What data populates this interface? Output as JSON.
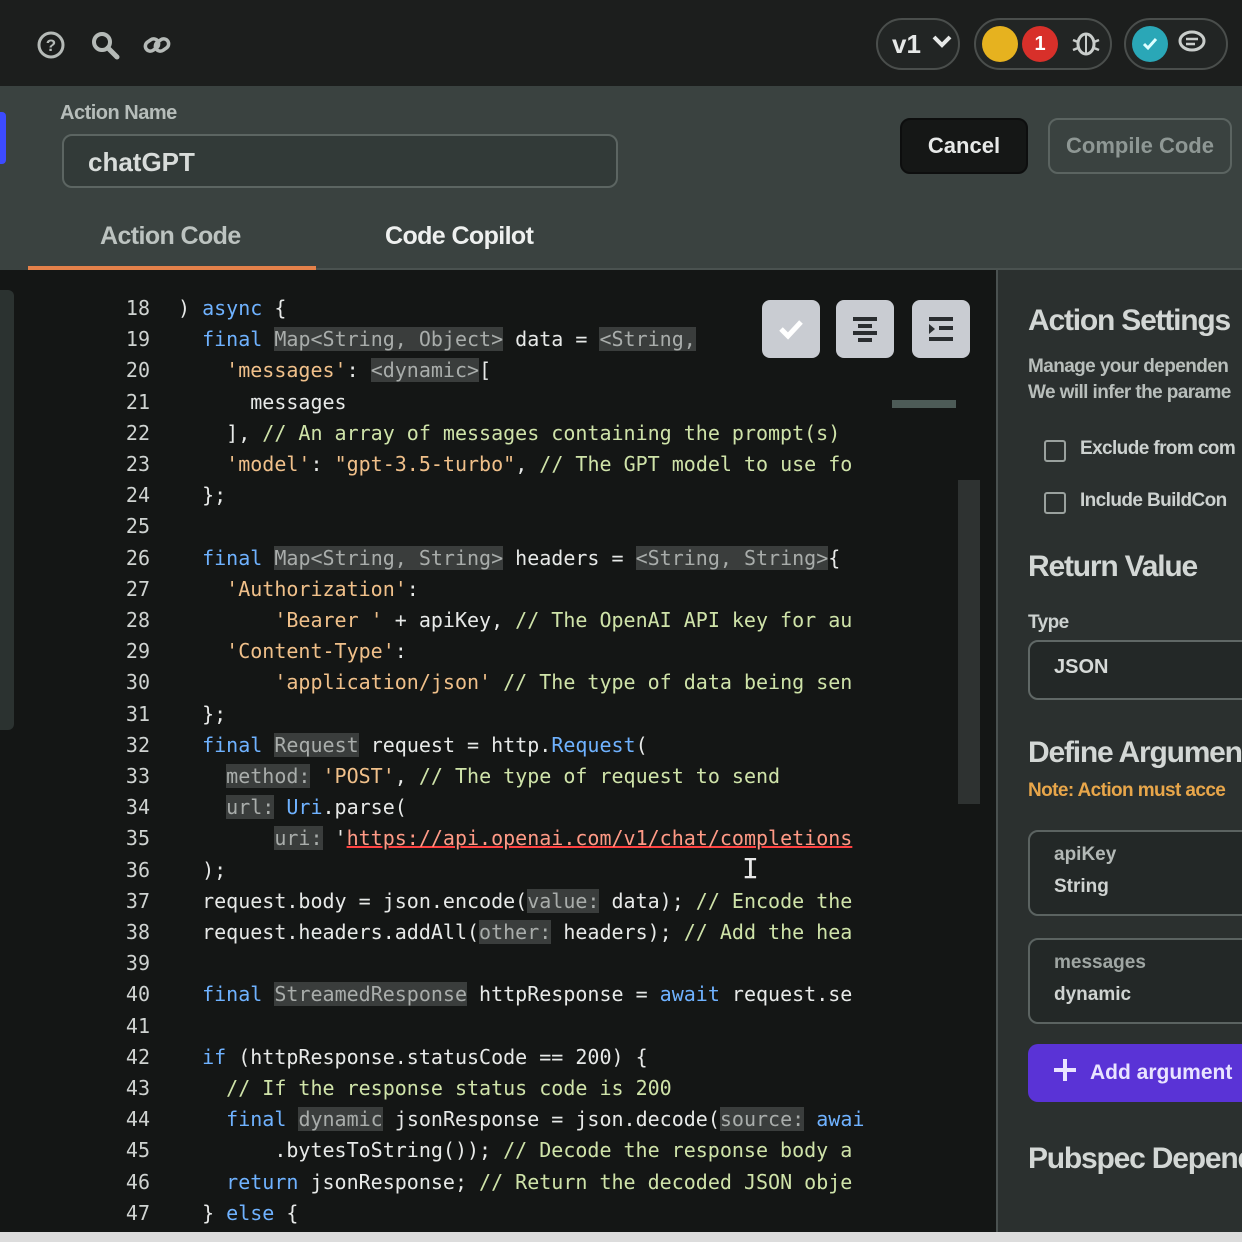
{
  "topbar": {
    "version_label": "v1",
    "badge_count": "1",
    "accent_colors": {
      "yellow": "#e6b21f",
      "red": "#d8302a",
      "teal": "#2aa7b7"
    }
  },
  "action": {
    "name_label": "Action Name",
    "name_value": "chatGPT",
    "cancel_label": "Cancel",
    "compile_label": "Compile Code"
  },
  "tabs": [
    {
      "label": "Action Code",
      "active": true
    },
    {
      "label": "Code Copilot",
      "active": false
    }
  ],
  "code": {
    "lines": [
      {
        "n": "18",
        "html": ") <span class=\"kw\">async</span> {"
      },
      {
        "n": "19",
        "html": "  <span class=\"kw\">final</span> <span class=\"hint\">Map&lt;String, Object&gt;</span> data = <span class=\"hint\">&lt;String,</span>"
      },
      {
        "n": "20",
        "html": "    <span class=\"str\">'messages'</span>: <span class=\"hint\">&lt;dynamic&gt;</span>["
      },
      {
        "n": "21",
        "html": "      messages"
      },
      {
        "n": "22",
        "html": "    ], <span class=\"cmt\">// An array of messages containing the prompt(s)</span>"
      },
      {
        "n": "23",
        "html": "    <span class=\"str\">'model'</span>: <span class=\"str\">\"gpt-3.5-turbo\"</span>, <span class=\"cmt\">// The GPT model to use fo</span>"
      },
      {
        "n": "24",
        "html": "  };"
      },
      {
        "n": "25",
        "html": ""
      },
      {
        "n": "26",
        "html": "  <span class=\"kw\">final</span> <span class=\"hint\">Map&lt;String, String&gt;</span> headers = <span class=\"hint\">&lt;String, String&gt;</span>{"
      },
      {
        "n": "27",
        "html": "    <span class=\"str\">'Authorization'</span>:"
      },
      {
        "n": "28",
        "html": "        <span class=\"str\">'Bearer '</span> + apiKey, <span class=\"cmt\">// The OpenAI API key for au</span>"
      },
      {
        "n": "29",
        "html": "    <span class=\"str\">'Content-Type'</span>:"
      },
      {
        "n": "30",
        "html": "        <span class=\"str\">'application/json'</span> <span class=\"cmt\">// The type of data being sen</span>"
      },
      {
        "n": "31",
        "html": "  };"
      },
      {
        "n": "32",
        "html": "  <span class=\"kw\">final</span> <span class=\"hint\">Request</span> request = http.<span class=\"kw\">Request</span>("
      },
      {
        "n": "33",
        "html": "    <span class=\"hint\">method:</span> <span class=\"str\">'POST'</span>, <span class=\"cmt\">// The type of request to send</span>"
      },
      {
        "n": "34",
        "html": "    <span class=\"hint\">url:</span> <span class=\"kw\">Uri</span>.parse("
      },
      {
        "n": "35",
        "html": "        <span class=\"hint\">uri:</span> '<span class=\"url\">https://api.openai.com/v1/chat/completions</span>"
      },
      {
        "n": "36",
        "html": "  );"
      },
      {
        "n": "37",
        "html": "  request.body = json.encode(<span class=\"hint\">value:</span> data); <span class=\"cmt\">// Encode the</span>"
      },
      {
        "n": "38",
        "html": "  request.headers.addAll(<span class=\"hint\">other:</span> headers); <span class=\"cmt\">// Add the hea</span>"
      },
      {
        "n": "39",
        "html": ""
      },
      {
        "n": "40",
        "html": "  <span class=\"kw\">final</span> <span class=\"hint\">StreamedResponse</span> httpResponse = <span class=\"kw\">await</span> request.se"
      },
      {
        "n": "41",
        "html": ""
      },
      {
        "n": "42",
        "html": "  <span class=\"kw\">if</span> (httpResponse.statusCode == 200) {"
      },
      {
        "n": "43",
        "html": "    <span class=\"cmt\">// If the response status code is 200</span>"
      },
      {
        "n": "44",
        "html": "    <span class=\"kw\">final</span> <span class=\"hint\">dynamic</span> jsonResponse = json.decode(<span class=\"hint\">source:</span> <span class=\"kw\">awai</span>"
      },
      {
        "n": "45",
        "html": "        .bytesToString()); <span class=\"cmt\">// Decode the response body a</span>"
      },
      {
        "n": "46",
        "html": "    <span class=\"kw\">return</span> jsonResponse; <span class=\"cmt\">// Return the decoded JSON obje</span>"
      },
      {
        "n": "47",
        "html": "  } <span class=\"kw\">else</span> {"
      }
    ]
  },
  "settings": {
    "title": "Action Settings",
    "desc_line1": "Manage your dependen",
    "desc_line2": "We will infer the parame",
    "exclude_label": "Exclude from com",
    "include_label": "Include BuildCon",
    "return_title": "Return Value",
    "type_label": "Type",
    "type_value": "JSON",
    "define_title": "Define Argumen",
    "note": "Note: Action must acce",
    "args": [
      {
        "name": "apiKey",
        "type": "String"
      },
      {
        "name": "messages",
        "type": "dynamic"
      }
    ],
    "add_label": "Add argument",
    "pubspec_title": "Pubspec Depend"
  }
}
